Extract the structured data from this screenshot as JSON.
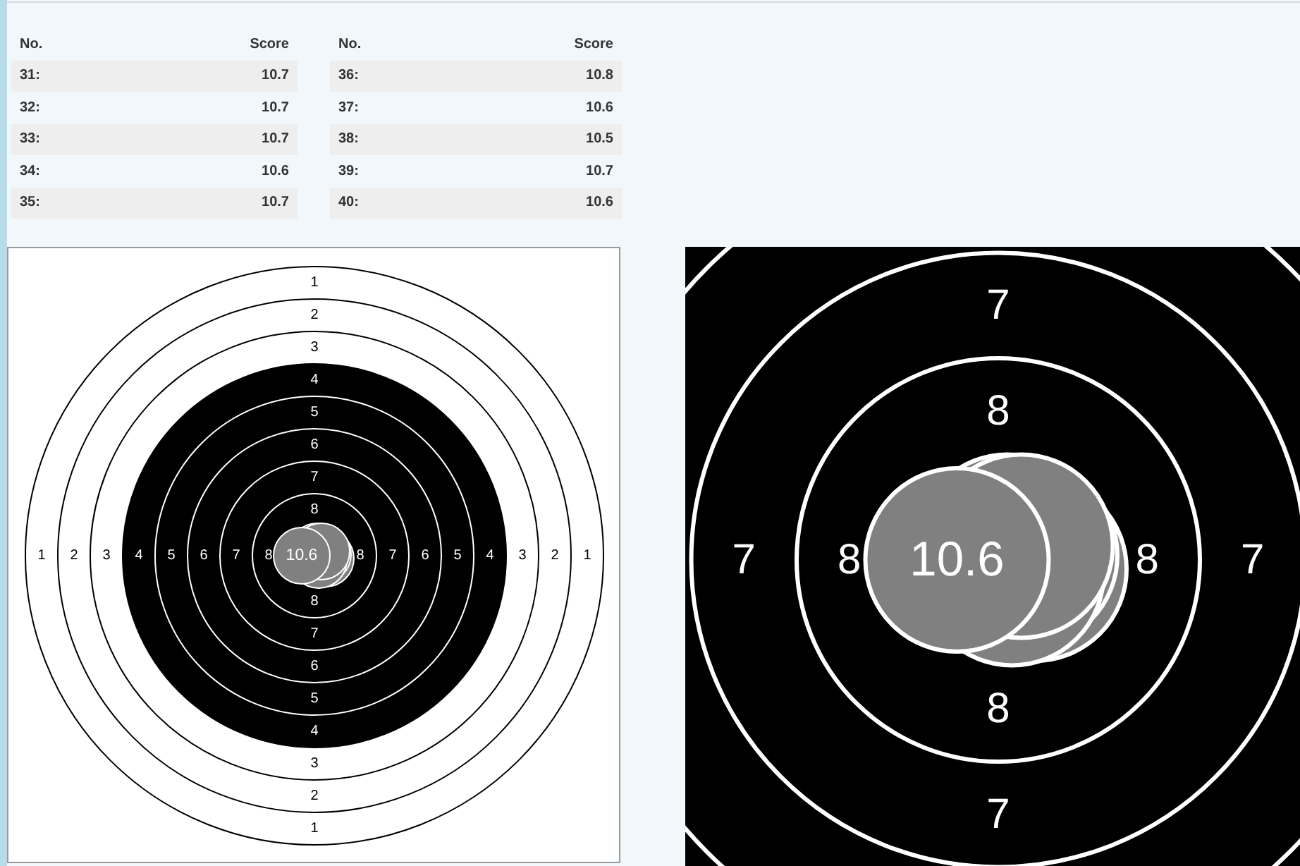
{
  "score_tables": [
    {
      "columns": [
        "No.",
        "Score"
      ],
      "rows": [
        {
          "no": "31:",
          "score": "10.7"
        },
        {
          "no": "32:",
          "score": "10.7"
        },
        {
          "no": "33:",
          "score": "10.7"
        },
        {
          "no": "34:",
          "score": "10.6"
        },
        {
          "no": "35:",
          "score": "10.7"
        }
      ]
    },
    {
      "columns": [
        "No.",
        "Score"
      ],
      "rows": [
        {
          "no": "36:",
          "score": "10.8"
        },
        {
          "no": "37:",
          "score": "10.6"
        },
        {
          "no": "38:",
          "score": "10.5"
        },
        {
          "no": "39:",
          "score": "10.7"
        },
        {
          "no": "40:",
          "score": "10.6"
        }
      ]
    }
  ],
  "full_target": {
    "rings": [
      {
        "labels": [
          "1",
          "1",
          "1",
          "1"
        ]
      },
      {
        "labels": [
          "2",
          "2",
          "2",
          "2"
        ]
      },
      {
        "labels": [
          "3",
          "3",
          "3",
          "3"
        ]
      },
      {
        "labels": [
          "4",
          "4",
          "4",
          "4"
        ]
      },
      {
        "labels": [
          "5",
          "5",
          "5",
          "5"
        ]
      },
      {
        "labels": [
          "6",
          "6",
          "6",
          "6"
        ]
      },
      {
        "labels": [
          "7",
          "7",
          "7",
          "7"
        ]
      },
      {
        "labels": [
          "8",
          "8",
          "8",
          "8"
        ]
      }
    ],
    "last_shot_label": "10.6"
  },
  "zoomed_target": {
    "rings": [
      {
        "labels": [
          "7",
          "7",
          "7",
          "7"
        ]
      },
      {
        "labels": [
          "8",
          "8",
          "8",
          "8"
        ]
      }
    ],
    "last_shot_label": "10.6"
  }
}
